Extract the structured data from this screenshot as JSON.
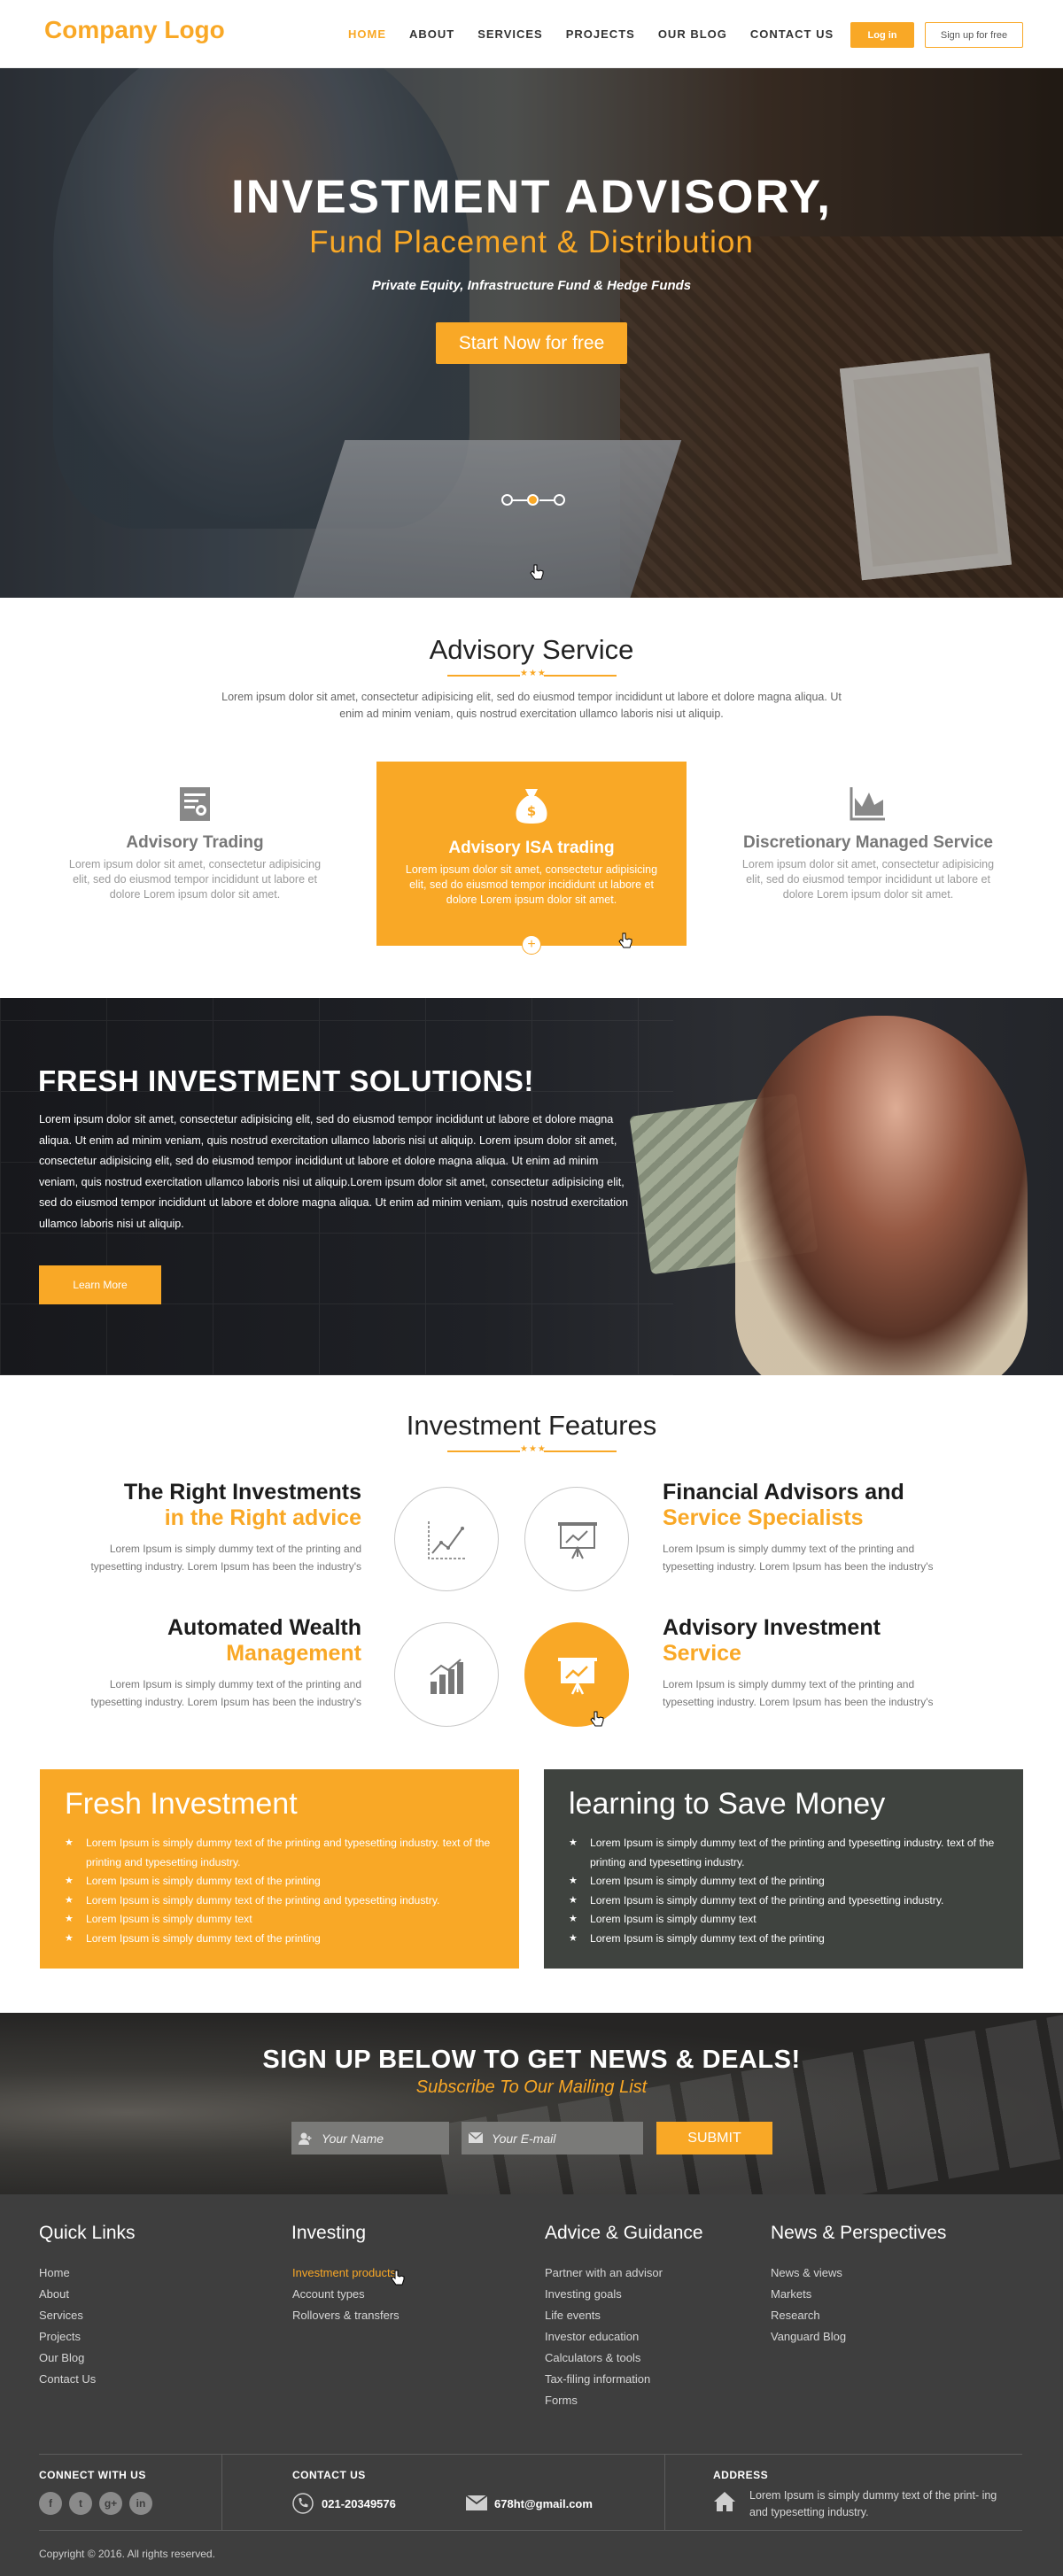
{
  "header": {
    "logo": "Company Logo",
    "nav": [
      "HOME",
      "ABOUT",
      "SERVICES",
      "PROJECTS",
      "OUR BLOG",
      "CONTACT US"
    ],
    "login_label": "Log in",
    "signup_label": "Sign up for free"
  },
  "hero": {
    "title": "INVESTMENT ADVISORY,",
    "subtitle": "Fund Placement & Distribution",
    "tagline": "Private Equity, Infrastructure Fund & Hedge Funds",
    "cta_label": "Start Now for free",
    "slide_count": 3,
    "active_slide": 2
  },
  "advisory": {
    "title": "Advisory Service",
    "intro": "Lorem ipsum dolor sit amet, consectetur adipisicing elit, sed do eiusmod tempor incididunt ut labore et dolore magna aliqua. Ut enim ad minim veniam, quis nostrud exercitation ullamco laboris nisi ut aliquip.",
    "services": [
      {
        "title": "Advisory Trading",
        "icon": "certificate-icon",
        "text": "Lorem ipsum dolor sit amet, consectetur adipisicing elit, sed do eiusmod tempor incididunt ut labore et dolore  Lorem ipsum dolor sit amet."
      },
      {
        "title": "Advisory ISA trading",
        "icon": "money-bag-icon",
        "text": "Lorem ipsum dolor sit amet, consectetur adipisicing elit, sed do eiusmod tempor incididunt ut labore et dolore  Lorem ipsum dolor sit amet."
      },
      {
        "title": "Discretionary Managed Service",
        "icon": "area-chart-icon",
        "text": "Lorem ipsum dolor sit amet, consectetur adipisicing elit, sed do eiusmod tempor incididunt ut labore et dolore  Lorem ipsum dolor sit amet."
      }
    ],
    "plus": "+"
  },
  "fresh": {
    "title": "FRESH INVESTMENT SOLUTIONS!",
    "text": "Lorem ipsum dolor sit amet, consectetur adipisicing elit, sed do eiusmod tempor incididunt ut labore et dolore magna aliqua. Ut enim ad minim veniam, quis nostrud exercitation ullamco laboris nisi ut aliquip. Lorem ipsum dolor sit amet, consectetur adipisicing elit, sed do eiusmod tempor incididunt ut labore et dolore magna aliqua. Ut enim ad minim veniam, quis nostrud exercitation ullamco laboris nisi ut aliquip.Lorem ipsum dolor sit amet, consectetur adipisicing elit, sed do eiusmod tempor incididunt ut labore et dolore magna aliqua. Ut enim ad minim veniam, quis nostrud exercitation ullamco laboris nisi ut aliquip.",
    "button_label": "Learn More"
  },
  "features": {
    "title": "Investment Features",
    "items": [
      {
        "line1": "The Right Investments",
        "line2": "in the Right advice",
        "icon": "line-chart-icon",
        "text": "Lorem Ipsum is simply dummy text of the printing and typesetting industry. Lorem Ipsum has been the industry's"
      },
      {
        "line1": "Financial Advisors and",
        "line2": "Service Specialists",
        "icon": "presentation-board-icon",
        "text": "Lorem Ipsum is simply dummy text of the printing and typesetting industry. Lorem Ipsum has been the industry's"
      },
      {
        "line1": "Automated Wealth",
        "line2": "Management",
        "icon": "bar-chart-icon",
        "text": "Lorem Ipsum is simply dummy text of the printing and typesetting industry. Lorem Ipsum has been the industry's"
      },
      {
        "line1": "Advisory Investment",
        "line2": "Service",
        "icon": "easel-chart-icon",
        "text": "Lorem Ipsum is simply dummy text of the printing and typesetting industry. Lorem Ipsum has been the industry's"
      }
    ]
  },
  "boxes": [
    {
      "title": "Fresh Investment",
      "items": [
        "Lorem Ipsum is simply dummy text of the printing and typesetting industry. text of the printing and typesetting industry.",
        "Lorem Ipsum is simply dummy text of the printing",
        "Lorem Ipsum is simply dummy text of the printing and typesetting industry.",
        "Lorem Ipsum is simply dummy text",
        "Lorem Ipsum is simply dummy text of the printing"
      ]
    },
    {
      "title": "learning to Save Money",
      "items": [
        "Lorem Ipsum is simply dummy text of the printing and typesetting industry. text of the printing and typesetting industry.",
        "Lorem Ipsum is simply dummy text of the printing",
        "Lorem Ipsum is simply dummy text of the printing and typesetting industry.",
        "Lorem Ipsum is simply dummy text",
        "Lorem Ipsum is simply dummy text of the printing"
      ]
    }
  ],
  "newsletter": {
    "title": "SIGN UP BELOW TO GET NEWS & DEALS!",
    "subtitle": "Subscribe To Our Mailing List",
    "name_placeholder": "Your Name",
    "email_placeholder": "Your E-mail",
    "submit_label": "SUBMIT"
  },
  "footer": {
    "columns": [
      {
        "heading": "Quick Links",
        "links": [
          "Home",
          "About",
          "Services",
          "Projects",
          "Our Blog",
          "Contact Us"
        ]
      },
      {
        "heading": "Investing",
        "links": [
          "Investment products",
          "Account types",
          "Rollovers & transfers"
        ]
      },
      {
        "heading": "Advice & Guidance",
        "links": [
          "Partner with an advisor",
          "Investing goals",
          "Life events",
          "Investor education",
          "Calculators & tools",
          "Tax-filing information",
          "Forms"
        ]
      },
      {
        "heading": "News & Perspectives",
        "links": [
          "News & views",
          "Markets",
          "Research",
          "Vanguard Blog"
        ]
      }
    ],
    "connect_label": "CONNECT WITH US",
    "social": [
      "facebook-icon",
      "twitter-icon",
      "google-plus-icon",
      "linkedin-icon"
    ],
    "contact_label": "CONTACT US",
    "phone": "021-20349576",
    "email": "678ht@gmail.com",
    "address_label": "ADDRESS",
    "address": "Lorem Ipsum is simply dummy text of the print- ing and typesetting industry.",
    "copyright": "Copyright © 2016. All rights reserved."
  },
  "colors": {
    "accent": "#f9a826",
    "dark_box": "#3f433f",
    "footer": "#3e3e3e"
  }
}
